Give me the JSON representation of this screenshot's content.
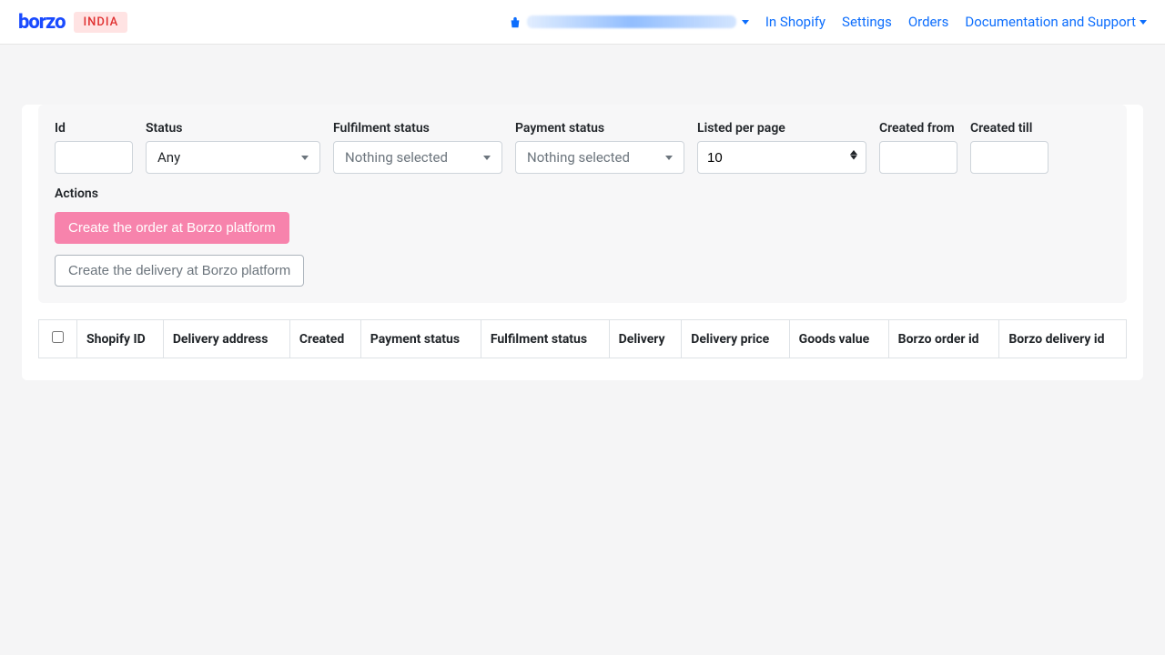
{
  "header": {
    "logo": "borzo",
    "badge": "INDIA",
    "nav": {
      "in_shopify": "In Shopify",
      "settings": "Settings",
      "orders": "Orders",
      "docs": "Documentation and Support"
    }
  },
  "filters": {
    "id": {
      "label": "Id",
      "value": ""
    },
    "status": {
      "label": "Status",
      "value": "Any"
    },
    "fulfilment": {
      "label": "Fulfilment status",
      "value": "Nothing selected"
    },
    "payment": {
      "label": "Payment status",
      "value": "Nothing selected"
    },
    "listed": {
      "label": "Listed per page",
      "value": "10"
    },
    "created_from": {
      "label": "Created from",
      "value": ""
    },
    "created_till": {
      "label": "Created till",
      "value": ""
    },
    "actions_label": "Actions",
    "btn_create_order": "Create the order at Borzo platform",
    "btn_create_delivery": "Create the delivery at Borzo platform"
  },
  "table": {
    "headers": [
      "Shopify ID",
      "Delivery address",
      "Created",
      "Payment status",
      "Fulfilment status",
      "Delivery",
      "Delivery price",
      "Goods value",
      "Borzo order id",
      "Borzo delivery id"
    ]
  }
}
